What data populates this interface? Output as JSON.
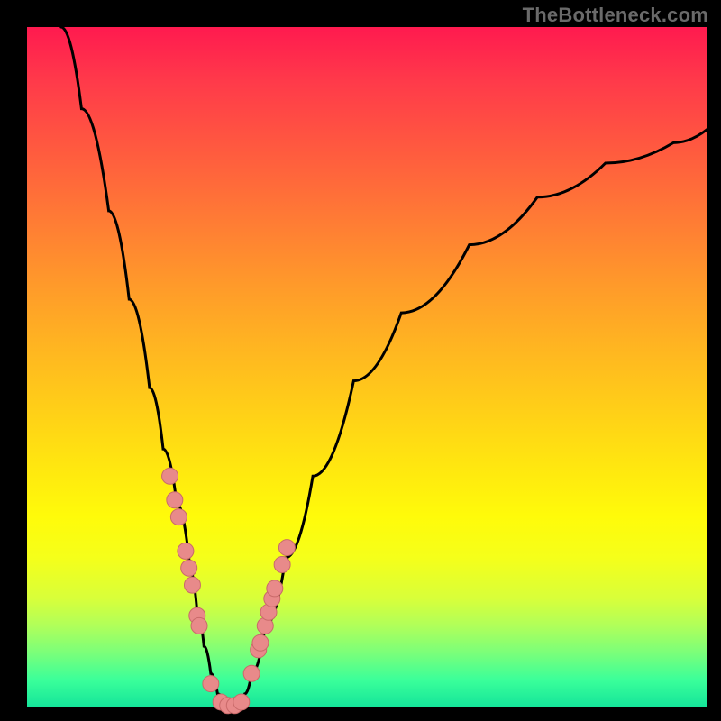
{
  "watermark": "TheBottleneck.com",
  "colors": {
    "background": "#000000",
    "gradient_top": "#ff1a4f",
    "gradient_bottom": "#14e49a",
    "curve": "#000000",
    "dot_fill": "#e88a8a",
    "dot_stroke": "#c96a6a"
  },
  "chart_data": {
    "type": "line",
    "title": "",
    "xlabel": "",
    "ylabel": "",
    "xlim": [
      0,
      100
    ],
    "ylim": [
      0,
      100
    ],
    "grid": false,
    "legend_position": "none",
    "series": [
      {
        "name": "curve",
        "x": [
          5,
          8,
          12,
          15,
          18,
          20,
          22,
          24,
          25,
          26,
          27,
          28,
          29,
          30,
          31,
          32,
          33,
          35,
          38,
          42,
          48,
          55,
          65,
          75,
          85,
          95,
          100
        ],
        "y": [
          100,
          88,
          73,
          60,
          47,
          38,
          30,
          20,
          14,
          9,
          5,
          2,
          1,
          0,
          1,
          2,
          5,
          12,
          22,
          34,
          48,
          58,
          68,
          75,
          80,
          83,
          85
        ]
      }
    ],
    "markers": {
      "name": "highlight-dots",
      "x": [
        21.0,
        21.7,
        22.3,
        23.3,
        23.8,
        24.3,
        25.0,
        25.3,
        27.0,
        28.5,
        29.5,
        30.5,
        31.5,
        33.0,
        34.0,
        34.3,
        35.0,
        35.5,
        36.0,
        36.4,
        37.5,
        38.2
      ],
      "y": [
        34.0,
        30.5,
        28.0,
        23.0,
        20.5,
        18.0,
        13.5,
        12.0,
        3.5,
        0.8,
        0.3,
        0.3,
        0.8,
        5.0,
        8.5,
        9.5,
        12.0,
        14.0,
        16.0,
        17.5,
        21.0,
        23.5
      ]
    }
  }
}
